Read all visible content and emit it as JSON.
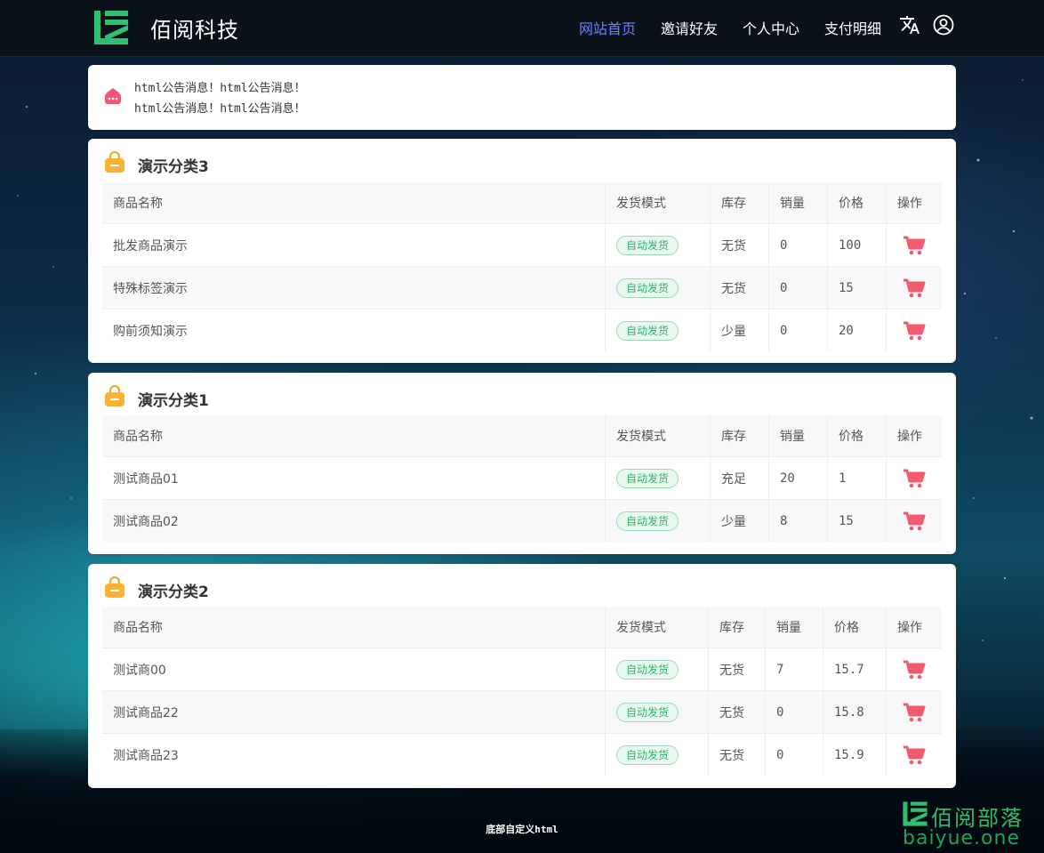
{
  "header": {
    "brand": "佰阅科技",
    "nav": [
      "网站首页",
      "邀请好友",
      "个人中心",
      "支付明细"
    ],
    "active_color": "#6f83ff"
  },
  "notice": {
    "lines": [
      "html公告消息！html公告消息！",
      "html公告消息！html公告消息！"
    ]
  },
  "columns": {
    "name": "商品名称",
    "mode": "发货模式",
    "stock": "库存",
    "sales": "销量",
    "price": "价格",
    "action": "操作"
  },
  "categories": [
    {
      "title": "演示分类3",
      "rows": [
        {
          "name": "批发商品演示",
          "mode": "自动发货",
          "stock": "无货",
          "sales": "0",
          "price": "100"
        },
        {
          "name": "特殊标签演示",
          "mode": "自动发货",
          "stock": "无货",
          "sales": "0",
          "price": "15"
        },
        {
          "name": "购前须知演示",
          "mode": "自动发货",
          "stock": "少量",
          "sales": "0",
          "price": "20"
        }
      ]
    },
    {
      "title": "演示分类1",
      "rows": [
        {
          "name": "测试商品01",
          "mode": "自动发货",
          "stock": "充足",
          "sales": "20",
          "price": "1"
        },
        {
          "name": "测试商品02",
          "mode": "自动发货",
          "stock": "少量",
          "sales": "8",
          "price": "15"
        }
      ]
    },
    {
      "title": "演示分类2",
      "rows": [
        {
          "name": "测试商00",
          "mode": "自动发货",
          "stock": "无货",
          "sales": "7",
          "price": "15.7"
        },
        {
          "name": "测试商品22",
          "mode": "自动发货",
          "stock": "无货",
          "sales": "0",
          "price": "15.8"
        },
        {
          "name": "测试商品23",
          "mode": "自动发货",
          "stock": "无货",
          "sales": "0",
          "price": "15.9"
        }
      ]
    }
  ],
  "footer": {
    "text": "底部自定义html"
  },
  "watermark": {
    "name": "佰阅部落",
    "url": "baiyue.one"
  }
}
